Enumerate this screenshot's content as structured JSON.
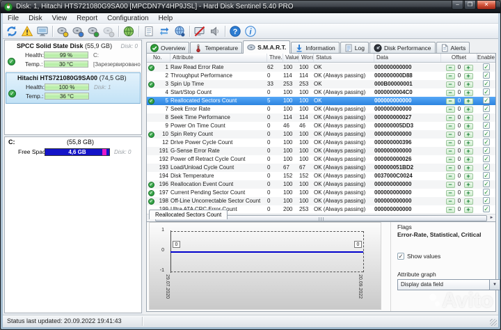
{
  "window": {
    "title": "Disk: 1, Hitachi HTS721080G9SA00 [MPCDN7Y4HP9JSL]  -  Hard Disk Sentinel 5.40 PRO",
    "status_bar": "Status last updated: 20.09.2022 19:41:43",
    "buttons": {
      "minimize": "–",
      "maximize": "❐",
      "close": "✕"
    }
  },
  "menu": [
    "File",
    "Disk",
    "View",
    "Report",
    "Configuration",
    "Help"
  ],
  "toolbar": {
    "items": [
      {
        "name": "refresh-icon"
      },
      {
        "name": "warning-icon"
      },
      {
        "name": "monitor-report-icon"
      },
      {
        "sep": true
      },
      {
        "name": "disk-test-yellow-icon"
      },
      {
        "name": "disk-test-blue-icon"
      },
      {
        "name": "disk-test-green-icon"
      },
      {
        "name": "disk-test-grey-icon",
        "disabled": true
      },
      {
        "sep": true
      },
      {
        "name": "globe-icon"
      },
      {
        "sep": true
      },
      {
        "name": "report-document-icon"
      },
      {
        "name": "sync-icon"
      },
      {
        "name": "network-globe-icon"
      },
      {
        "sep": true
      },
      {
        "name": "monitor-off-icon"
      },
      {
        "name": "speaker-icon"
      },
      {
        "sep": true
      },
      {
        "name": "help-icon"
      },
      {
        "name": "info-icon"
      }
    ]
  },
  "sidebar": {
    "disks": [
      {
        "name": "SPCC Solid State Disk",
        "size": "(55,9 GB)",
        "disk_label": "Disk: 0",
        "health_label": "Health:",
        "health": "99 %",
        "temp_label": "Temp.:",
        "temp": "30 °C",
        "health_right": "C:",
        "temp_right": "[Зарезервировано сис",
        "ok_icon": "✓"
      },
      {
        "name": "Hitachi HTS721080G9SA00",
        "size": "(74,5 GB)",
        "disk_label": "Disk: 1",
        "health_label": "Health:",
        "health": "100 %",
        "temp_label": "Temp.:",
        "temp": "36 °C",
        "ok_icon": "✓"
      }
    ],
    "partition": {
      "name": "C:",
      "size": "(55,8 GB)",
      "free_label": "Free Space",
      "free": "4,6 GB",
      "disk_label": "Disk: 0"
    }
  },
  "tabs": [
    {
      "label": "Overview",
      "icon": "overview-check-icon"
    },
    {
      "label": "Temperature",
      "icon": "thermometer-icon"
    },
    {
      "label": "S.M.A.R.T.",
      "icon": "smart-disk-icon",
      "active": true
    },
    {
      "label": "Information",
      "icon": "information-icon"
    },
    {
      "label": "Log",
      "icon": "log-icon"
    },
    {
      "label": "Disk Performance",
      "icon": "disk-performance-icon"
    },
    {
      "label": "Alerts",
      "icon": "alerts-icon"
    }
  ],
  "smart_table": {
    "headers": [
      "No.",
      "Attribute",
      "Thre...",
      "Value",
      "Worst",
      "Status",
      "Data",
      "Offset",
      "Enable"
    ],
    "rows": [
      {
        "no": "1",
        "attribute": "Raw Read Error Rate",
        "threshold": "62",
        "value": "100",
        "worst": "100",
        "status": "OK",
        "data": "000000000000",
        "offset": "0",
        "ok_icon": true,
        "enabled": true
      },
      {
        "no": "2",
        "attribute": "Throughput Performance",
        "threshold": "0",
        "value": "114",
        "worst": "114",
        "status": "OK (Always passing)",
        "data": "000000000D88",
        "offset": "0",
        "ok_icon": false,
        "enabled": true
      },
      {
        "no": "3",
        "attribute": "Spin Up Time",
        "threshold": "33",
        "value": "253",
        "worst": "253",
        "status": "OK",
        "data": "000B00000001",
        "offset": "0",
        "ok_icon": true,
        "enabled": true
      },
      {
        "no": "4",
        "attribute": "Start/Stop Count",
        "threshold": "0",
        "value": "100",
        "worst": "100",
        "status": "OK (Always passing)",
        "data": "0000000004C0",
        "offset": "0",
        "ok_icon": false,
        "enabled": true
      },
      {
        "no": "5",
        "attribute": "Reallocated Sectors Count",
        "threshold": "5",
        "value": "100",
        "worst": "100",
        "status": "OK",
        "data": "000000000000",
        "offset": "0",
        "ok_icon": true,
        "enabled": true,
        "selected": true
      },
      {
        "no": "7",
        "attribute": "Seek Error Rate",
        "threshold": "0",
        "value": "100",
        "worst": "100",
        "status": "OK (Always passing)",
        "data": "000000000000",
        "offset": "0",
        "ok_icon": false,
        "enabled": true
      },
      {
        "no": "8",
        "attribute": "Seek Time Performance",
        "threshold": "0",
        "value": "114",
        "worst": "114",
        "status": "OK (Always passing)",
        "data": "000000000027",
        "offset": "0",
        "ok_icon": false,
        "enabled": true
      },
      {
        "no": "9",
        "attribute": "Power On Time Count",
        "threshold": "0",
        "value": "46",
        "worst": "46",
        "status": "OK (Always passing)",
        "data": "000000005DD3",
        "offset": "0",
        "ok_icon": false,
        "enabled": true
      },
      {
        "no": "10",
        "attribute": "Spin Retry Count",
        "threshold": "0",
        "value": "100",
        "worst": "100",
        "status": "OK (Always passing)",
        "data": "000000000000",
        "offset": "0",
        "ok_icon": true,
        "enabled": true
      },
      {
        "no": "12",
        "attribute": "Drive Power Cycle Count",
        "threshold": "0",
        "value": "100",
        "worst": "100",
        "status": "OK (Always passing)",
        "data": "000000000396",
        "offset": "0",
        "ok_icon": false,
        "enabled": true
      },
      {
        "no": "191",
        "attribute": "G-Sense Error Rate",
        "threshold": "0",
        "value": "100",
        "worst": "100",
        "status": "OK (Always passing)",
        "data": "000000000000",
        "offset": "0",
        "ok_icon": false,
        "enabled": true
      },
      {
        "no": "192",
        "attribute": "Power off Retract Cycle Count",
        "threshold": "0",
        "value": "100",
        "worst": "100",
        "status": "OK (Always passing)",
        "data": "000000000026",
        "offset": "0",
        "ok_icon": false,
        "enabled": true
      },
      {
        "no": "193",
        "attribute": "Load/Unload Cycle Count",
        "threshold": "0",
        "value": "67",
        "worst": "67",
        "status": "OK (Always passing)",
        "data": "000000051BD2",
        "offset": "0",
        "ok_icon": false,
        "enabled": true
      },
      {
        "no": "194",
        "attribute": "Disk Temperature",
        "threshold": "0",
        "value": "152",
        "worst": "152",
        "status": "OK (Always passing)",
        "data": "0037000C0024",
        "offset": "0",
        "ok_icon": false,
        "enabled": true
      },
      {
        "no": "196",
        "attribute": "Reallocation Event Count",
        "threshold": "0",
        "value": "100",
        "worst": "100",
        "status": "OK (Always passing)",
        "data": "000000000000",
        "offset": "0",
        "ok_icon": true,
        "enabled": true
      },
      {
        "no": "197",
        "attribute": "Current Pending Sector Count",
        "threshold": "0",
        "value": "100",
        "worst": "100",
        "status": "OK (Always passing)",
        "data": "000000000000",
        "offset": "0",
        "ok_icon": true,
        "enabled": true
      },
      {
        "no": "198",
        "attribute": "Off-Line Uncorrectable Sector Count",
        "threshold": "0",
        "value": "100",
        "worst": "100",
        "status": "OK (Always passing)",
        "data": "000000000000",
        "offset": "0",
        "ok_icon": true,
        "enabled": true
      },
      {
        "no": "199",
        "attribute": "Ultra ATA CRC Error Count",
        "threshold": "0",
        "value": "200",
        "worst": "253",
        "status": "OK (Always passing)",
        "data": "000000000000",
        "offset": "0",
        "ok_icon": false,
        "enabled": true
      }
    ]
  },
  "detail": {
    "tab": "Reallocated Sectors Count",
    "flags_label": "Flags",
    "flags": "Error-Rate, Statistical, Critical",
    "show_values_label": "Show values",
    "show_values_checked": "✓",
    "attribute_graph_label": "Attribute graph",
    "graph_dropdown": "Display data field",
    "dropdown_arrow": "▼"
  },
  "chart_data": {
    "type": "line",
    "title": "Reallocated Sectors Count",
    "x": [
      "29.07.2020",
      "20.09.2022"
    ],
    "values": [
      0,
      0
    ],
    "point_labels": [
      "0",
      "0"
    ],
    "y_ticks": [
      "1",
      "0",
      "-1"
    ],
    "ylim": [
      -1,
      1
    ],
    "line_color": "#0000cc",
    "legend_position": "none",
    "grid": "dashed-top-bottom"
  },
  "watermark": "Avito",
  "colors": {
    "selection_blue": "#2c84e0",
    "health_green": "#b5eda5",
    "free_space_blue": "#1414c8",
    "free_space_magenta": "#e619c9",
    "ok_green": "#2a9a3c",
    "graph_line": "#0000cc"
  }
}
